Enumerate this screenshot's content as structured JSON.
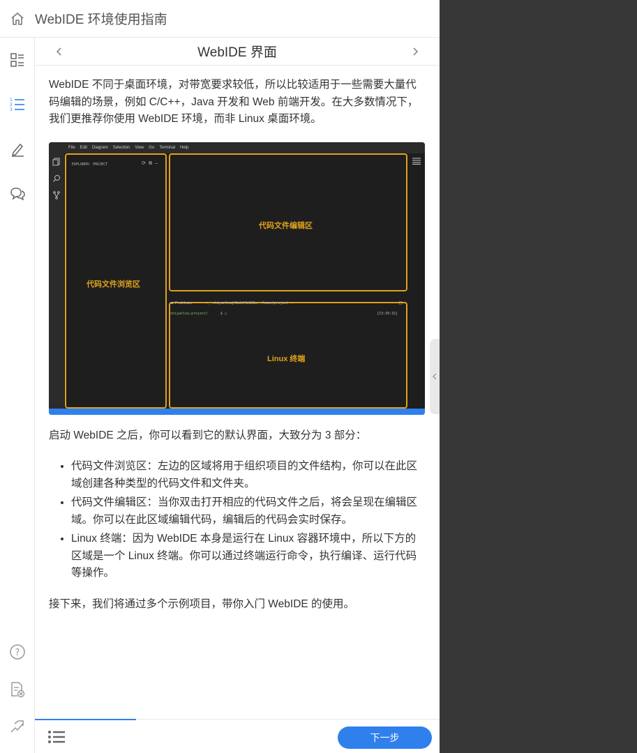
{
  "header": {
    "title": "WebIDE 环境使用指南"
  },
  "chapter": {
    "title": "WebIDE 界面",
    "prev_icon": "chevron-left-icon",
    "next_icon": "chevron-right-icon"
  },
  "rail": {
    "items": [
      {
        "icon": "contents-icon"
      },
      {
        "icon": "numbered-list-icon",
        "active": true
      },
      {
        "icon": "edit-icon"
      },
      {
        "icon": "comments-icon"
      },
      {
        "icon": "help-icon"
      },
      {
        "icon": "report-icon"
      },
      {
        "icon": "exit-icon"
      }
    ]
  },
  "content": {
    "intro": "WebIDE 不同于桌面环境，对带宽要求较低，所以比较适用于一些需要大量代码编辑的场景，例如 C/C++，Java 开发和 Web 前端开发。在大多数情况下，我们更推荐你使用 WebIDE 环境，而非 Linux 桌面环境。",
    "figure": {
      "menu": [
        "File",
        "Edit",
        "Diagram",
        "Selection",
        "View",
        "Go",
        "Terminal",
        "Help"
      ],
      "explorer_title": "EXPLORER: PROJECT",
      "zone_explorer": "代码文件浏览区",
      "zone_editor": "代码文件编辑区",
      "zone_terminal": "Linux 终端",
      "tab_problems": "Problems",
      "tab_terminal": "shiyanlou@42eb94b623e: /home/project",
      "prompt_user": "shiyanlou:project/",
      "prompt_symbol": "$",
      "time": "[13:39:32]"
    },
    "lead": "启动 WebIDE 之后，你可以看到它的默认界面，大致分为 3 部分：",
    "bullets": [
      "代码文件浏览区：左边的区域将用于组织项目的文件结构，你可以在此区域创建各种类型的代码文件和文件夹。",
      "代码文件编辑区：当你双击打开相应的代码文件之后，将会呈现在编辑区域。你可以在此区域编辑代码，编辑后的代码会实时保存。",
      "Linux 终端：因为 WebIDE 本身是运行在 Linux 容器环境中，所以下方的区域是一个 Linux 终端。你可以通过终端运行命令，执行编译、运行代码等操作。"
    ],
    "outro": "接下来，我们将通过多个示例项目，带你入门 WebIDE 的使用。"
  },
  "footer": {
    "next_label": "下一步",
    "progress": 0.25,
    "toc_icon": "toc-list-icon"
  },
  "colors": {
    "accent": "#2f80ed",
    "highlight": "#e0a21b"
  }
}
